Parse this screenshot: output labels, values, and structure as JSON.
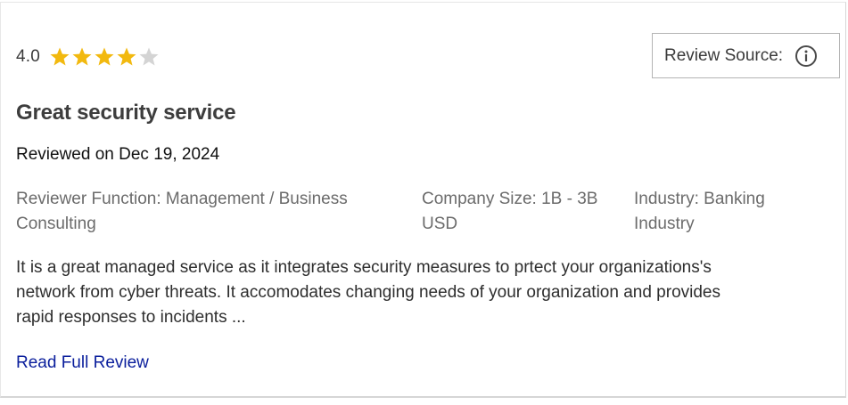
{
  "review": {
    "rating_value": "4.0",
    "rating_stars": 4,
    "rating_max": 5,
    "star_colors": {
      "filled": "#f2b90f",
      "empty": "#d4d4d4"
    },
    "source_label": "Review Source:",
    "info_icon": "info-circle-icon",
    "title": "Great security service",
    "reviewed_on": "Reviewed on Dec 19, 2024",
    "meta": {
      "function_line1": "Reviewer Function: Management / Business",
      "function_line2": "Consulting",
      "size_line1": "Company Size: 1B - 3B",
      "size_line2": "USD",
      "industry_line1": "Industry: Banking",
      "industry_line2": "Industry"
    },
    "body_line1": "It is a great managed service as it integrates security measures to prtect your organizations's",
    "body_line2": "network from cyber threats. It accomodates changing needs of your organization and provides",
    "body_line3": "rapid responses to incidents ...",
    "read_full_label": "Read Full Review",
    "link_color": "#0a1e9c"
  }
}
